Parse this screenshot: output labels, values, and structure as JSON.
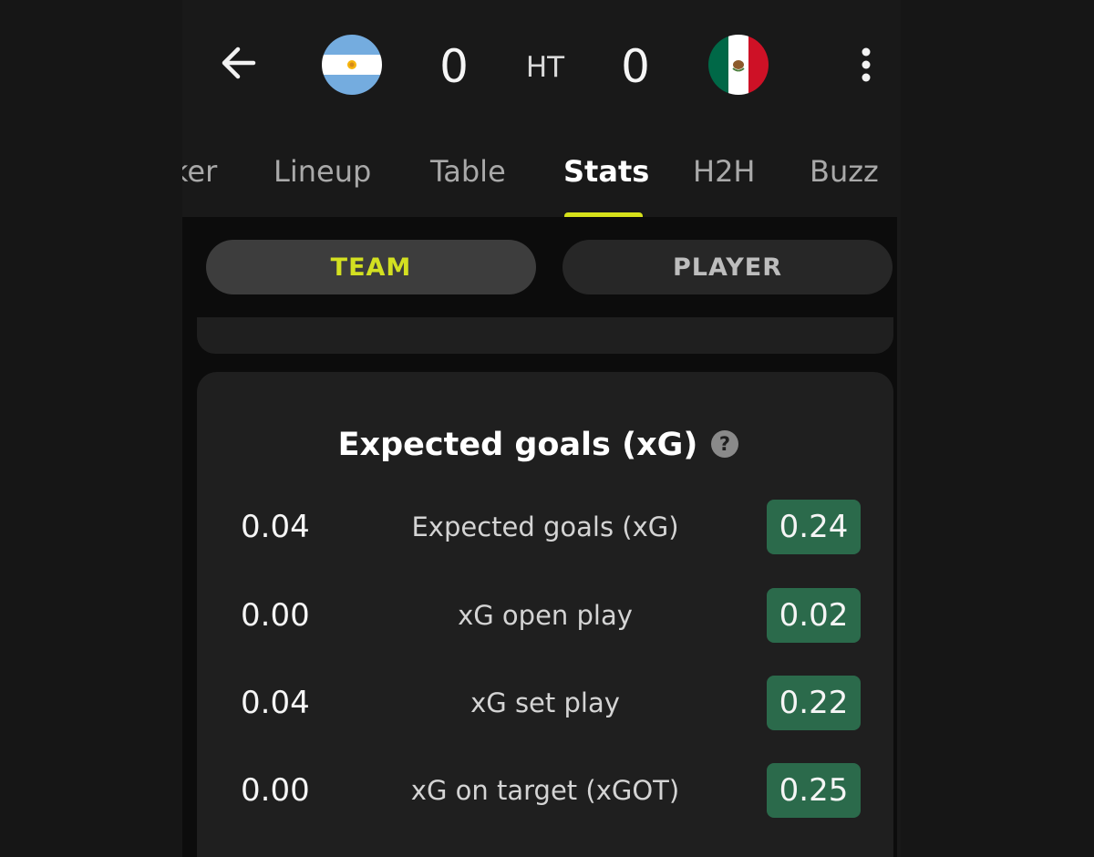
{
  "header": {
    "home_team": {
      "flag_icon": "argentina-flag-icon",
      "score": "0"
    },
    "away_team": {
      "flag_icon": "mexico-flag-icon",
      "score": "0"
    },
    "status": "HT"
  },
  "tabs": [
    {
      "label": "ker"
    },
    {
      "label": "Lineup"
    },
    {
      "label": "Table"
    },
    {
      "label": "Stats",
      "active": true
    },
    {
      "label": "H2H"
    },
    {
      "label": "Buzz"
    }
  ],
  "segments": {
    "team_label": "TEAM",
    "player_label": "PLAYER",
    "selected": "TEAM"
  },
  "expected_goals": {
    "title": "Expected goals (xG)",
    "rows": [
      {
        "home": "0.04",
        "label": "Expected goals (xG)",
        "away": "0.24"
      },
      {
        "home": "0.00",
        "label": "xG open play",
        "away": "0.02"
      },
      {
        "home": "0.04",
        "label": "xG set play",
        "away": "0.22"
      },
      {
        "home": "0.00",
        "label": "xG on target (xGOT)",
        "away": "0.25"
      }
    ]
  },
  "colors": {
    "accent": "#d6e11a",
    "highlight_green": "#2b6a4b",
    "background": "#191919",
    "card": "#1f1f1f"
  }
}
